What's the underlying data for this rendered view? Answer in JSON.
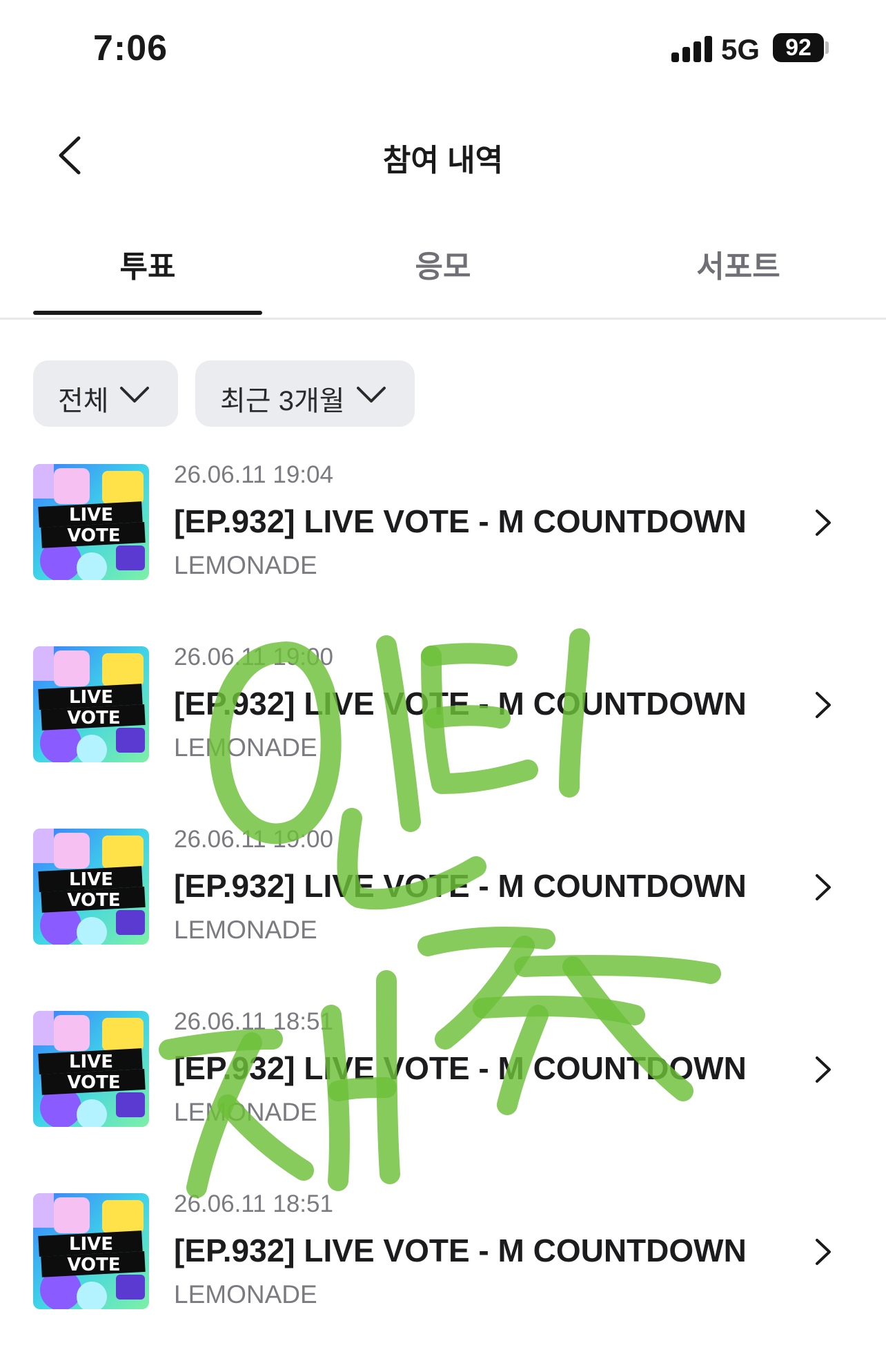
{
  "status_bar": {
    "time": "7:06",
    "network": "5G",
    "battery": "92"
  },
  "header": {
    "title": "참여 내역"
  },
  "tabs": [
    {
      "label": "투표",
      "active": true
    },
    {
      "label": "응모",
      "active": false
    },
    {
      "label": "서포트",
      "active": false
    }
  ],
  "filters": {
    "category": "전체",
    "period": "최근 3개월"
  },
  "thumbnail": {
    "line1": "LIVE",
    "line2": "VOTE"
  },
  "items": [
    {
      "date": "26.06.11 19:04",
      "title": "[EP.932] LIVE VOTE - M COUNTDOWN",
      "subtitle": "LEMONADE"
    },
    {
      "date": "26.06.11 19:00",
      "title": "[EP.932] LIVE VOTE - M COUNTDOWN",
      "subtitle": "LEMONADE"
    },
    {
      "date": "26.06.11 19:00",
      "title": "[EP.932] LIVE VOTE - M COUNTDOWN",
      "subtitle": "LEMONADE"
    },
    {
      "date": "26.06.11 18:51",
      "title": "[EP.932] LIVE VOTE - M COUNTDOWN",
      "subtitle": "LEMONADE"
    },
    {
      "date": "26.06.11 18:51",
      "title": "[EP.932] LIVE VOTE - M COUNTDOWN",
      "subtitle": "LEMONADE"
    }
  ],
  "overlay": {
    "handwriting_text": "인티 재촉",
    "color": "#6cc038"
  },
  "icons": {
    "back": "chevron-left-icon",
    "item_arrow": "chevron-right-icon",
    "dropdown": "chevron-down-icon"
  }
}
